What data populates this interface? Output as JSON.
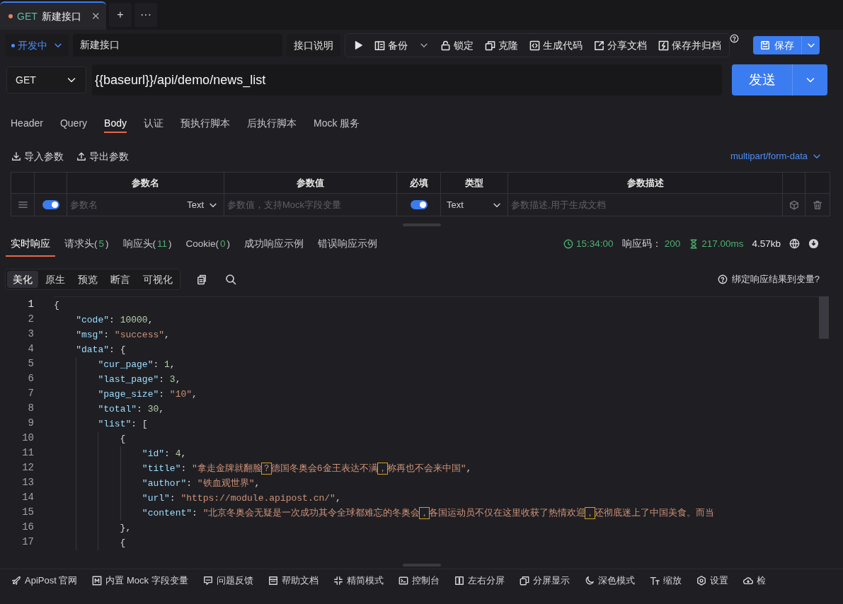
{
  "tabs": [
    {
      "method": "GET",
      "title": "新建接口",
      "close": "✕",
      "selected": true
    }
  ],
  "tab_actions": [
    "+",
    "···"
  ],
  "api": {
    "status": "开发中",
    "name": "新建接口",
    "doc_button": "接口说明",
    "actions": [
      {
        "kind": "play"
      },
      {
        "kind": "backup",
        "label": "备份"
      },
      {
        "kind": "lock",
        "label": "锁定"
      },
      {
        "kind": "clone",
        "label": "克隆"
      },
      {
        "kind": "code",
        "label": "生成代码"
      },
      {
        "kind": "share",
        "label": "分享文档"
      },
      {
        "kind": "archive",
        "label": "保存并归档"
      }
    ],
    "save": "保存"
  },
  "request": {
    "method": "GET",
    "url": "{{baseurl}}/api/demo/news_list",
    "send": "发送"
  },
  "request_tabs": [
    {
      "label": "Header",
      "selected": false
    },
    {
      "label": "Query",
      "selected": false
    },
    {
      "label": "Body",
      "selected": true
    },
    {
      "label": "认证",
      "selected": false
    },
    {
      "label": "预执行脚本",
      "selected": false
    },
    {
      "label": "后执行脚本",
      "selected": false
    },
    {
      "label": "Mock 服务",
      "selected": false
    }
  ],
  "body_tools": {
    "import": "导入参数",
    "export": "导出参数",
    "content_type": "multipart/form-data"
  },
  "params_table": {
    "columns": [
      "参数名",
      "参数值",
      "必填",
      "类型",
      "参数描述"
    ],
    "rows": [
      {
        "enabled": true,
        "name_placeholder": "参数名",
        "name_type": "Text",
        "value_placeholder": "参数值，支持Mock字段变量",
        "required": true,
        "type": "Text",
        "description_placeholder": "参数描述,用于生成文档"
      }
    ]
  },
  "response_tabs": [
    {
      "label": "实时响应",
      "selected": true
    },
    {
      "label": "请求头(",
      "count": "5",
      "suffix": ")",
      "selected": false
    },
    {
      "label": "响应头(",
      "count": "11",
      "suffix": ")",
      "selected": false
    },
    {
      "label": "Cookie(",
      "count": "0",
      "suffix": ")",
      "selected": false
    },
    {
      "label": "成功响应示例",
      "selected": false
    },
    {
      "label": "错误响应示例",
      "selected": false
    }
  ],
  "response_meta": {
    "time": "15:34:00",
    "code_label": "响应码：",
    "code": "200",
    "duration": "217.00ms",
    "size": "4.57kb"
  },
  "view_modes": [
    {
      "label": "美化",
      "selected": true
    },
    {
      "label": "原生",
      "selected": false
    },
    {
      "label": "预览",
      "selected": false
    },
    {
      "label": "断言",
      "selected": false
    },
    {
      "label": "可视化",
      "selected": false
    }
  ],
  "bind_hint": "绑定响应结果到变量?",
  "code_lines": [
    {
      "number": "1",
      "text": "{"
    },
    {
      "number": "2",
      "text": "    \"code\": 10000,"
    },
    {
      "number": "3",
      "text": "    \"msg\": \"success\","
    },
    {
      "number": "4",
      "text": "    \"data\": {"
    },
    {
      "number": "5",
      "text": "        \"cur_page\": 1,"
    },
    {
      "number": "6",
      "text": "        \"last_page\": 3,"
    },
    {
      "number": "7",
      "text": "        \"page_size\": \"10\","
    },
    {
      "number": "8",
      "text": "        \"total\": 30,"
    },
    {
      "number": "9",
      "text": "        \"list\": ["
    },
    {
      "number": "10",
      "text": "            {"
    },
    {
      "number": "11",
      "text": "                \"id\": 4,"
    },
    {
      "number": "12",
      "text": "                \"title\": \"拿走金牌就翻脸？德国冬奥会6金王表达不满，称再也不会来中国\","
    },
    {
      "number": "13",
      "text": "                \"author\": \"铁血观世界\","
    },
    {
      "number": "14",
      "text": "                \"url\": \"https://module.apipost.cn/\","
    },
    {
      "number": "15",
      "text": "                \"content\": \"北京冬奥会无疑是一次成功其令全球都难忘的冬奥会，各国运动员不仅在这里收获了热情欢迎，还彻底迷上了中国美食。而当"
    },
    {
      "number": "16",
      "text": "            },"
    },
    {
      "number": "17",
      "text": "            {"
    }
  ],
  "footer": [
    {
      "kind": "rocket",
      "label": "ApiPost 官网"
    },
    {
      "kind": "mock",
      "label": "内置 Mock 字段变量"
    },
    {
      "kind": "feedback",
      "label": "问题反馈"
    },
    {
      "kind": "doc",
      "label": "帮助文档"
    },
    {
      "kind": "compact",
      "label": "精简模式"
    },
    {
      "kind": "console",
      "label": "控制台"
    },
    {
      "kind": "split",
      "label": "左右分屏"
    },
    {
      "kind": "screens",
      "label": "分屏显示"
    },
    {
      "kind": "moon",
      "label": "深色模式"
    },
    {
      "kind": "zoom",
      "label": "缩放"
    },
    {
      "kind": "gear",
      "label": "设置"
    },
    {
      "kind": "cloud",
      "label": "检"
    }
  ]
}
